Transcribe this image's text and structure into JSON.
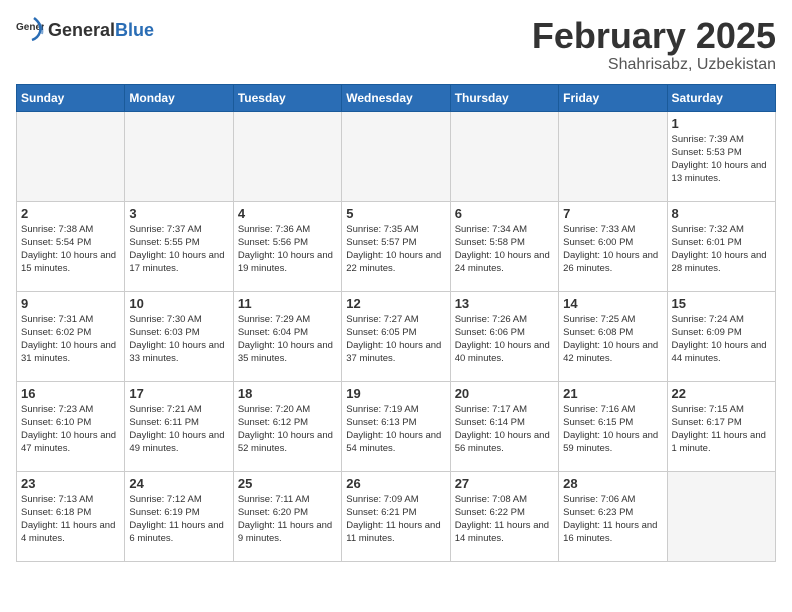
{
  "header": {
    "logo_general": "General",
    "logo_blue": "Blue",
    "month_year": "February 2025",
    "location": "Shahrisabz, Uzbekistan"
  },
  "weekdays": [
    "Sunday",
    "Monday",
    "Tuesday",
    "Wednesday",
    "Thursday",
    "Friday",
    "Saturday"
  ],
  "weeks": [
    [
      {
        "day": "",
        "info": ""
      },
      {
        "day": "",
        "info": ""
      },
      {
        "day": "",
        "info": ""
      },
      {
        "day": "",
        "info": ""
      },
      {
        "day": "",
        "info": ""
      },
      {
        "day": "",
        "info": ""
      },
      {
        "day": "1",
        "info": "Sunrise: 7:39 AM\nSunset: 5:53 PM\nDaylight: 10 hours and 13 minutes."
      }
    ],
    [
      {
        "day": "2",
        "info": "Sunrise: 7:38 AM\nSunset: 5:54 PM\nDaylight: 10 hours and 15 minutes."
      },
      {
        "day": "3",
        "info": "Sunrise: 7:37 AM\nSunset: 5:55 PM\nDaylight: 10 hours and 17 minutes."
      },
      {
        "day": "4",
        "info": "Sunrise: 7:36 AM\nSunset: 5:56 PM\nDaylight: 10 hours and 19 minutes."
      },
      {
        "day": "5",
        "info": "Sunrise: 7:35 AM\nSunset: 5:57 PM\nDaylight: 10 hours and 22 minutes."
      },
      {
        "day": "6",
        "info": "Sunrise: 7:34 AM\nSunset: 5:58 PM\nDaylight: 10 hours and 24 minutes."
      },
      {
        "day": "7",
        "info": "Sunrise: 7:33 AM\nSunset: 6:00 PM\nDaylight: 10 hours and 26 minutes."
      },
      {
        "day": "8",
        "info": "Sunrise: 7:32 AM\nSunset: 6:01 PM\nDaylight: 10 hours and 28 minutes."
      }
    ],
    [
      {
        "day": "9",
        "info": "Sunrise: 7:31 AM\nSunset: 6:02 PM\nDaylight: 10 hours and 31 minutes."
      },
      {
        "day": "10",
        "info": "Sunrise: 7:30 AM\nSunset: 6:03 PM\nDaylight: 10 hours and 33 minutes."
      },
      {
        "day": "11",
        "info": "Sunrise: 7:29 AM\nSunset: 6:04 PM\nDaylight: 10 hours and 35 minutes."
      },
      {
        "day": "12",
        "info": "Sunrise: 7:27 AM\nSunset: 6:05 PM\nDaylight: 10 hours and 37 minutes."
      },
      {
        "day": "13",
        "info": "Sunrise: 7:26 AM\nSunset: 6:06 PM\nDaylight: 10 hours and 40 minutes."
      },
      {
        "day": "14",
        "info": "Sunrise: 7:25 AM\nSunset: 6:08 PM\nDaylight: 10 hours and 42 minutes."
      },
      {
        "day": "15",
        "info": "Sunrise: 7:24 AM\nSunset: 6:09 PM\nDaylight: 10 hours and 44 minutes."
      }
    ],
    [
      {
        "day": "16",
        "info": "Sunrise: 7:23 AM\nSunset: 6:10 PM\nDaylight: 10 hours and 47 minutes."
      },
      {
        "day": "17",
        "info": "Sunrise: 7:21 AM\nSunset: 6:11 PM\nDaylight: 10 hours and 49 minutes."
      },
      {
        "day": "18",
        "info": "Sunrise: 7:20 AM\nSunset: 6:12 PM\nDaylight: 10 hours and 52 minutes."
      },
      {
        "day": "19",
        "info": "Sunrise: 7:19 AM\nSunset: 6:13 PM\nDaylight: 10 hours and 54 minutes."
      },
      {
        "day": "20",
        "info": "Sunrise: 7:17 AM\nSunset: 6:14 PM\nDaylight: 10 hours and 56 minutes."
      },
      {
        "day": "21",
        "info": "Sunrise: 7:16 AM\nSunset: 6:15 PM\nDaylight: 10 hours and 59 minutes."
      },
      {
        "day": "22",
        "info": "Sunrise: 7:15 AM\nSunset: 6:17 PM\nDaylight: 11 hours and 1 minute."
      }
    ],
    [
      {
        "day": "23",
        "info": "Sunrise: 7:13 AM\nSunset: 6:18 PM\nDaylight: 11 hours and 4 minutes."
      },
      {
        "day": "24",
        "info": "Sunrise: 7:12 AM\nSunset: 6:19 PM\nDaylight: 11 hours and 6 minutes."
      },
      {
        "day": "25",
        "info": "Sunrise: 7:11 AM\nSunset: 6:20 PM\nDaylight: 11 hours and 9 minutes."
      },
      {
        "day": "26",
        "info": "Sunrise: 7:09 AM\nSunset: 6:21 PM\nDaylight: 11 hours and 11 minutes."
      },
      {
        "day": "27",
        "info": "Sunrise: 7:08 AM\nSunset: 6:22 PM\nDaylight: 11 hours and 14 minutes."
      },
      {
        "day": "28",
        "info": "Sunrise: 7:06 AM\nSunset: 6:23 PM\nDaylight: 11 hours and 16 minutes."
      },
      {
        "day": "",
        "info": ""
      }
    ]
  ]
}
